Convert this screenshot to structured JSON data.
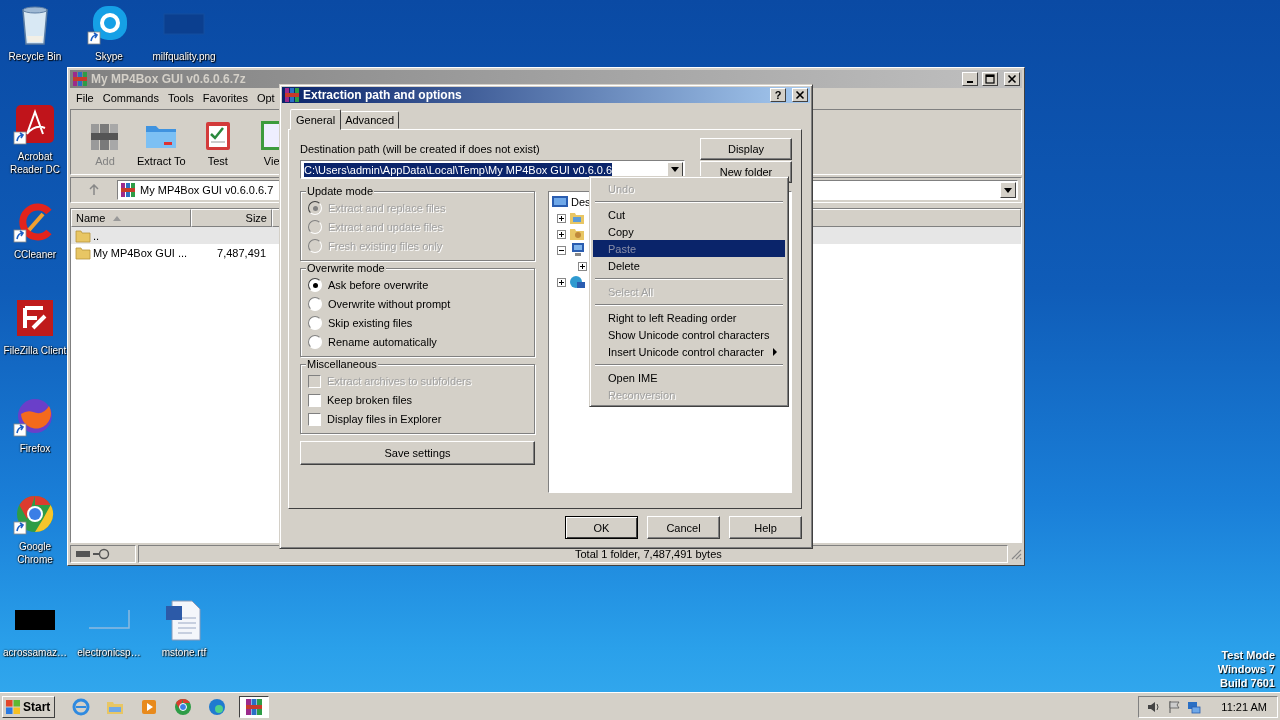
{
  "desktop_icons": [
    {
      "kind": "recycle-bin",
      "label": "Recycle Bin",
      "shortcut": false
    },
    {
      "kind": "chat-app",
      "label": "Skype",
      "shortcut": true
    },
    {
      "kind": "dark-image",
      "label": "milfquality.png",
      "shortcut": false
    },
    {
      "kind": "pdf-app",
      "label": "Acrobat Reader DC",
      "shortcut": true
    },
    {
      "kind": "cleaner-app",
      "label": "CCleaner",
      "shortcut": true
    },
    {
      "kind": "ftp-app",
      "label": "FileZilla Client",
      "shortcut": false
    },
    {
      "kind": "fox-app",
      "label": "Firefox",
      "shortcut": true
    },
    {
      "kind": "chrome-app",
      "label": "Google Chrome",
      "shortcut": true
    },
    {
      "kind": "black-image",
      "label": "acrossamaz…",
      "shortcut": false
    },
    {
      "kind": "blank-image",
      "label": "electronicsp…",
      "shortcut": false
    },
    {
      "kind": "word-doc",
      "label": "mstone.rtf",
      "shortcut": false
    }
  ],
  "test_mode": [
    "Test Mode",
    "Windows 7",
    "Build 7601"
  ],
  "rar_window": {
    "title": "My MP4Box GUI v0.6.0.6.7z",
    "menu": [
      "File",
      "Commands",
      "Tools",
      "Favorites",
      "Opt"
    ],
    "toolbar": [
      {
        "kind": "add",
        "label": "Add",
        "disabled": true
      },
      {
        "kind": "extract",
        "label": "Extract To",
        "disabled": false
      },
      {
        "kind": "test",
        "label": "Test",
        "disabled": false
      },
      {
        "kind": "view",
        "label": "Vie",
        "disabled": false
      }
    ],
    "address": "My MP4Box GUI v0.6.0.6.7",
    "columns": [
      {
        "label": "Name",
        "sorted": true
      },
      {
        "label": "Size",
        "sorted": false
      }
    ],
    "rows": [
      {
        "name": "..",
        "selected": true
      },
      {
        "name": "My MP4Box GUI ...",
        "size": "7,487,491",
        "selected": false
      }
    ],
    "status": "Total 1 folder, 7,487,491 bytes"
  },
  "dialog": {
    "title": "Extraction path and options",
    "help": "?",
    "tabs": [
      {
        "label": "General",
        "selected": true
      },
      {
        "label": "Advanced",
        "selected": false
      }
    ],
    "path_label": "Destination path (will be created if does not exist)",
    "path": "C:\\Users\\admin\\AppData\\Local\\Temp\\My MP4Box GUI v0.6.0.6",
    "path_selected": true,
    "side_buttons": [
      "Display",
      "New folder"
    ],
    "groups": [
      {
        "title": "Update mode",
        "kind": "radio",
        "options": [
          {
            "label": "Extract and replace files",
            "selected": true,
            "disabled": true
          },
          {
            "label": "Extract and update files",
            "selected": false,
            "disabled": true
          },
          {
            "label": "Fresh existing files only",
            "selected": false,
            "disabled": true
          }
        ]
      },
      {
        "title": "Overwrite mode",
        "kind": "radio",
        "options": [
          {
            "label": "Ask before overwrite",
            "selected": true,
            "disabled": false
          },
          {
            "label": "Overwrite without prompt",
            "selected": false,
            "disabled": false
          },
          {
            "label": "Skip existing files",
            "selected": false,
            "disabled": false
          },
          {
            "label": "Rename automatically",
            "selected": false,
            "disabled": false
          }
        ]
      },
      {
        "title": "Miscellaneous",
        "kind": "checkbox",
        "options": [
          {
            "label": "Extract archives to subfolders",
            "checked": false,
            "disabled": true
          },
          {
            "label": "Keep broken files",
            "checked": false,
            "disabled": false
          },
          {
            "label": "Display files in Explorer",
            "checked": false,
            "disabled": false
          }
        ]
      }
    ],
    "save_button": "Save settings",
    "tree": [
      {
        "kind": "desktop",
        "label": "Des",
        "children": [
          {
            "kind": "library",
            "expanded": false
          },
          {
            "kind": "user",
            "expanded": false
          },
          {
            "kind": "computer",
            "expanded": true,
            "children": [
              {
                "expanded": false
              }
            ]
          },
          {
            "kind": "network",
            "expanded": false
          }
        ]
      }
    ],
    "buttons": [
      {
        "label": "OK",
        "default": true
      },
      {
        "label": "Cancel",
        "default": false
      },
      {
        "label": "Help",
        "default": false
      }
    ]
  },
  "context_menu": [
    {
      "kind": "item",
      "label": "Undo",
      "disabled": true,
      "selected": false,
      "submenu": false
    },
    {
      "kind": "separator"
    },
    {
      "kind": "item",
      "label": "Cut",
      "disabled": false,
      "selected": false,
      "submenu": false
    },
    {
      "kind": "item",
      "label": "Copy",
      "disabled": false,
      "selected": false,
      "submenu": false
    },
    {
      "kind": "item",
      "label": "Paste",
      "disabled": true,
      "selected": true,
      "submenu": false
    },
    {
      "kind": "item",
      "label": "Delete",
      "disabled": false,
      "selected": false,
      "submenu": false
    },
    {
      "kind": "separator"
    },
    {
      "kind": "item",
      "label": "Select All",
      "disabled": true,
      "selected": false,
      "submenu": false
    },
    {
      "kind": "separator"
    },
    {
      "kind": "item",
      "label": "Right to left Reading order",
      "disabled": false,
      "selected": false,
      "submenu": false
    },
    {
      "kind": "item",
      "label": "Show Unicode control characters",
      "disabled": false,
      "selected": false,
      "submenu": false
    },
    {
      "kind": "item",
      "label": "Insert Unicode control character",
      "disabled": false,
      "selected": false,
      "submenu": true
    },
    {
      "kind": "separator"
    },
    {
      "kind": "item",
      "label": "Open IME",
      "disabled": false,
      "selected": false,
      "submenu": false
    },
    {
      "kind": "item",
      "label": "Reconversion",
      "disabled": true,
      "selected": false,
      "submenu": false
    }
  ],
  "taskbar": {
    "start": "Start",
    "apps": [
      {
        "kind": "ie",
        "selected": false
      },
      {
        "kind": "folder",
        "selected": false
      },
      {
        "kind": "media",
        "selected": false
      },
      {
        "kind": "chrome",
        "selected": false
      },
      {
        "kind": "edge",
        "selected": false
      },
      {
        "kind": "archiver",
        "selected": true
      }
    ],
    "clock": "11:21 AM"
  }
}
